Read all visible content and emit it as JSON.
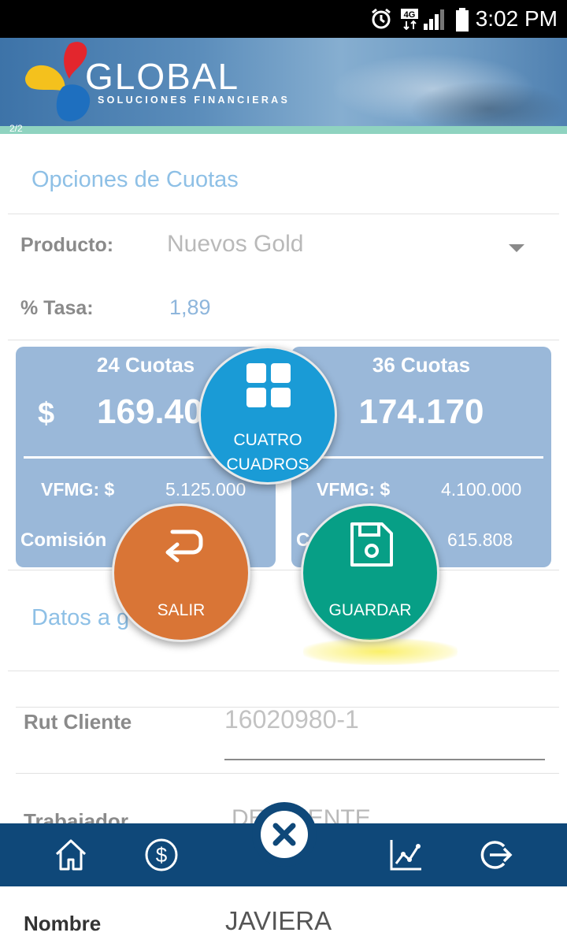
{
  "status_bar": {
    "time": "3:02 PM",
    "network": "4G",
    "icons": [
      "alarm-icon",
      "network-4g-icon",
      "signal-icon",
      "battery-icon"
    ]
  },
  "header": {
    "brand": "GLOBAL",
    "subtitle": "SOLUCIONES FINANCIERAS",
    "tiny_label": "2/2"
  },
  "cuotas_section": {
    "title": "Opciones de Cuotas",
    "producto_label": "Producto:",
    "producto_value": "Nuevos Gold",
    "tasa_label": "% Tasa:",
    "tasa_value": "1,89"
  },
  "cards": [
    {
      "cuotas": "24 Cuotas",
      "currency": "$",
      "amount": "169.40",
      "vfmg_label": "VFMG: $",
      "vfmg_value": "5.125.000",
      "comision_label": "Comisión"
    },
    {
      "cuotas": "36 Cuotas",
      "amount": "174.170",
      "vfmg_label": "VFMG: $",
      "vfmg_value": "4.100.000",
      "comision_label": "C",
      "comision_value": "615.808"
    }
  ],
  "fab_menu": {
    "cuatro_line1": "CUATRO",
    "cuatro_line2": "CUADROS",
    "salir": "SALIR",
    "guardar": "GUARDAR"
  },
  "datos_section": {
    "title": "Datos a g",
    "rut_label": "Rut Cliente",
    "rut_value": "16020980-1",
    "trabajador_label": "Trabajador",
    "trabajador_value": "DE CLIENTE",
    "nombre_label": "Nombre",
    "nombre_value": "JAVIERA"
  },
  "bottom_nav": {
    "items": [
      "home-icon",
      "dollar-icon",
      "close-icon",
      "chart-icon",
      "logout-icon"
    ]
  },
  "colors": {
    "nav": "#0f4879",
    "card": "#9ab8d9",
    "cuatro": "#1a9bd6",
    "salir": "#d97536",
    "guardar": "#079f86",
    "section_title": "#8ec0e6"
  }
}
